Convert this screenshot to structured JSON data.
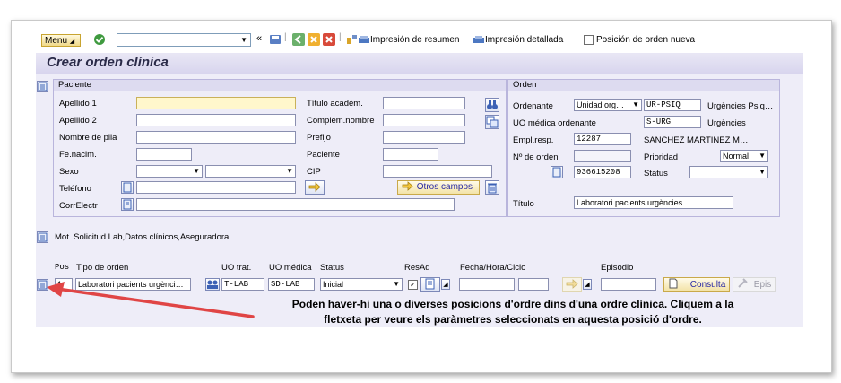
{
  "toolbar": {
    "menu_label": "Menu",
    "impresion_resumen": "Impresión de resumen",
    "impresion_detallada": "Impresión detallada",
    "posicion_nueva": "Posición de orden nueva"
  },
  "title": "Crear orden clínica",
  "paciente": {
    "header": "Paciente",
    "apellido1_label": "Apellido 1",
    "apellido2_label": "Apellido 2",
    "nombre_label": "Nombre de pila",
    "fenacim_label": "Fe.nacim.",
    "sexo_label": "Sexo",
    "telefono_label": "Teléfono",
    "correo_label": "CorrElectr",
    "titulo_acad_label": "Título académ.",
    "complem_label": "Complem.nombre",
    "prefijo_label": "Prefijo",
    "paciente_label": "Paciente",
    "cip_label": "CIP",
    "otros_campos": "Otros campos"
  },
  "orden": {
    "header": "Orden",
    "ordenante_label": "Ordenante",
    "ordenante_select": "Unidad org…",
    "ordenante_code": "UR-PSIQ",
    "ordenante_desc": "Urgències Psiq…",
    "uo_medica_label": "UO médica ordenante",
    "uo_medica_code": "S-URG",
    "uo_medica_desc": "Urgències",
    "emplresp_label": "Empl.resp.",
    "emplresp_value": "12287",
    "emplresp_name": "SANCHEZ MARTINEZ M…",
    "nro_orden_label": "Nº de orden",
    "prioridad_label": "Prioridad",
    "prioridad_value": "Normal",
    "orden_number": "936615208",
    "status_label": "Status",
    "titulo_label": "Título",
    "titulo_value": "Laboratori pacients urgències"
  },
  "mot_solicitud": "Mot. Solicitud Lab,Datos clínicos,Aseguradora",
  "positions": {
    "headers": {
      "pos": "Pos",
      "tipo": "Tipo de orden",
      "uo_trat": "UO trat.",
      "uo_medica": "UO médica",
      "status": "Status",
      "resad": "ResAd",
      "fecha": "Fecha/Hora/Ciclo",
      "episodio": "Episodio"
    },
    "row": {
      "pos": "1",
      "tipo": "Laboratori pacients urgènci…",
      "uo_trat": "T-LAB",
      "uo_medica": "SD-LAB",
      "status": "Inicial",
      "consulta": "Consulta",
      "epis": "Epis"
    }
  },
  "note": {
    "line1": "Poden haver-hi una o diverses posicions d'ordre dins d'una ordre clínica. Cliquem a la",
    "line2": "fletxeta per veure els paràmetres seleccionats en aquesta posició d'ordre."
  },
  "colors": {
    "title_band": "#d8d5ee",
    "work_area": "#eeedf8",
    "arrow": "#e04545",
    "required_field": "#fff7cc"
  }
}
